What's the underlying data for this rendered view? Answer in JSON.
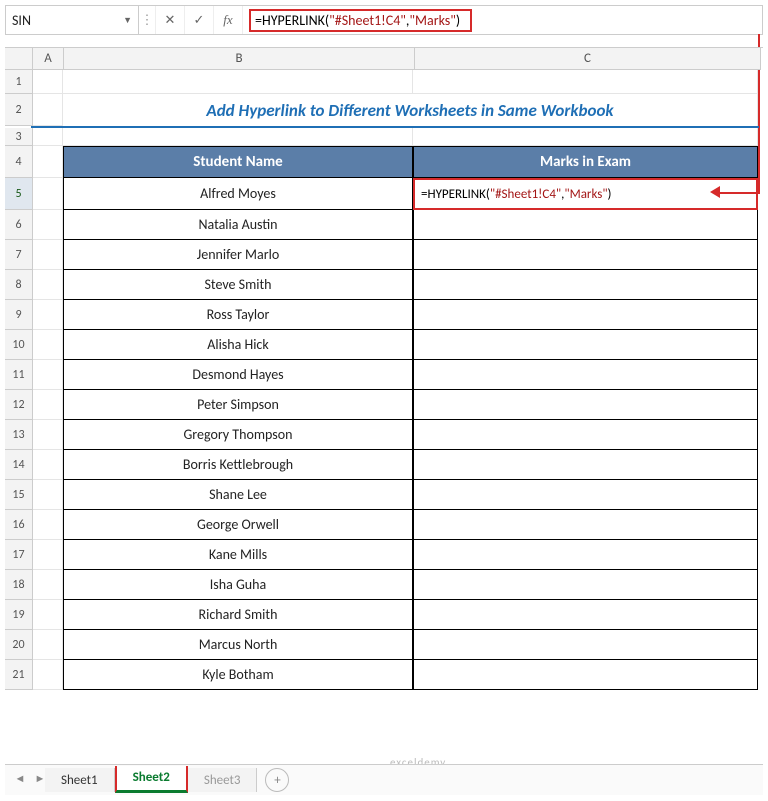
{
  "namebox": "SIN",
  "formula": {
    "prefix": "=HYPERLINK(",
    "arg1": "\"#Sheet1!C4\"",
    "sep": ",",
    "arg2": "\"Marks\"",
    "suffix": ")"
  },
  "columns": {
    "A": "A",
    "B": "B",
    "C": "C"
  },
  "title": "Add Hyperlink to Different Worksheets in Same Workbook",
  "headers": {
    "name": "Student Name",
    "marks": "Marks in Exam"
  },
  "students": [
    "Alfred Moyes",
    "Natalia Austin",
    "Jennifer Marlo",
    "Steve Smith",
    "Ross Taylor",
    "Alisha Hick",
    "Desmond Hayes",
    "Peter Simpson",
    "Gregory Thompson",
    "Borris Kettlebrough",
    "Shane Lee",
    "George Orwell",
    "Kane Mills",
    "Isha Guha",
    "Richard Smith",
    "Marcus North",
    "Kyle Botham"
  ],
  "cellFormula": {
    "prefix": "=HYPERLINK(",
    "arg1": "\"#Sheet1!C4\"",
    "sep": ",",
    "arg2": "\"Marks\"",
    "suffix": ")"
  },
  "tabs": {
    "s1": "Sheet1",
    "s2": "Sheet2",
    "s3": "Sheet3"
  },
  "watermark": "exceldemy",
  "rows": [
    "1",
    "2",
    "3",
    "4",
    "5",
    "6",
    "7",
    "8",
    "9",
    "10",
    "11",
    "12",
    "13",
    "14",
    "15",
    "16",
    "17",
    "18",
    "19",
    "20",
    "21"
  ],
  "icons": {
    "plus": "+",
    "dots": "⋮",
    "x": "✕",
    "check": "✓",
    "fx": "fx",
    "dd": "▼",
    "left": "◄",
    "right": "►"
  }
}
